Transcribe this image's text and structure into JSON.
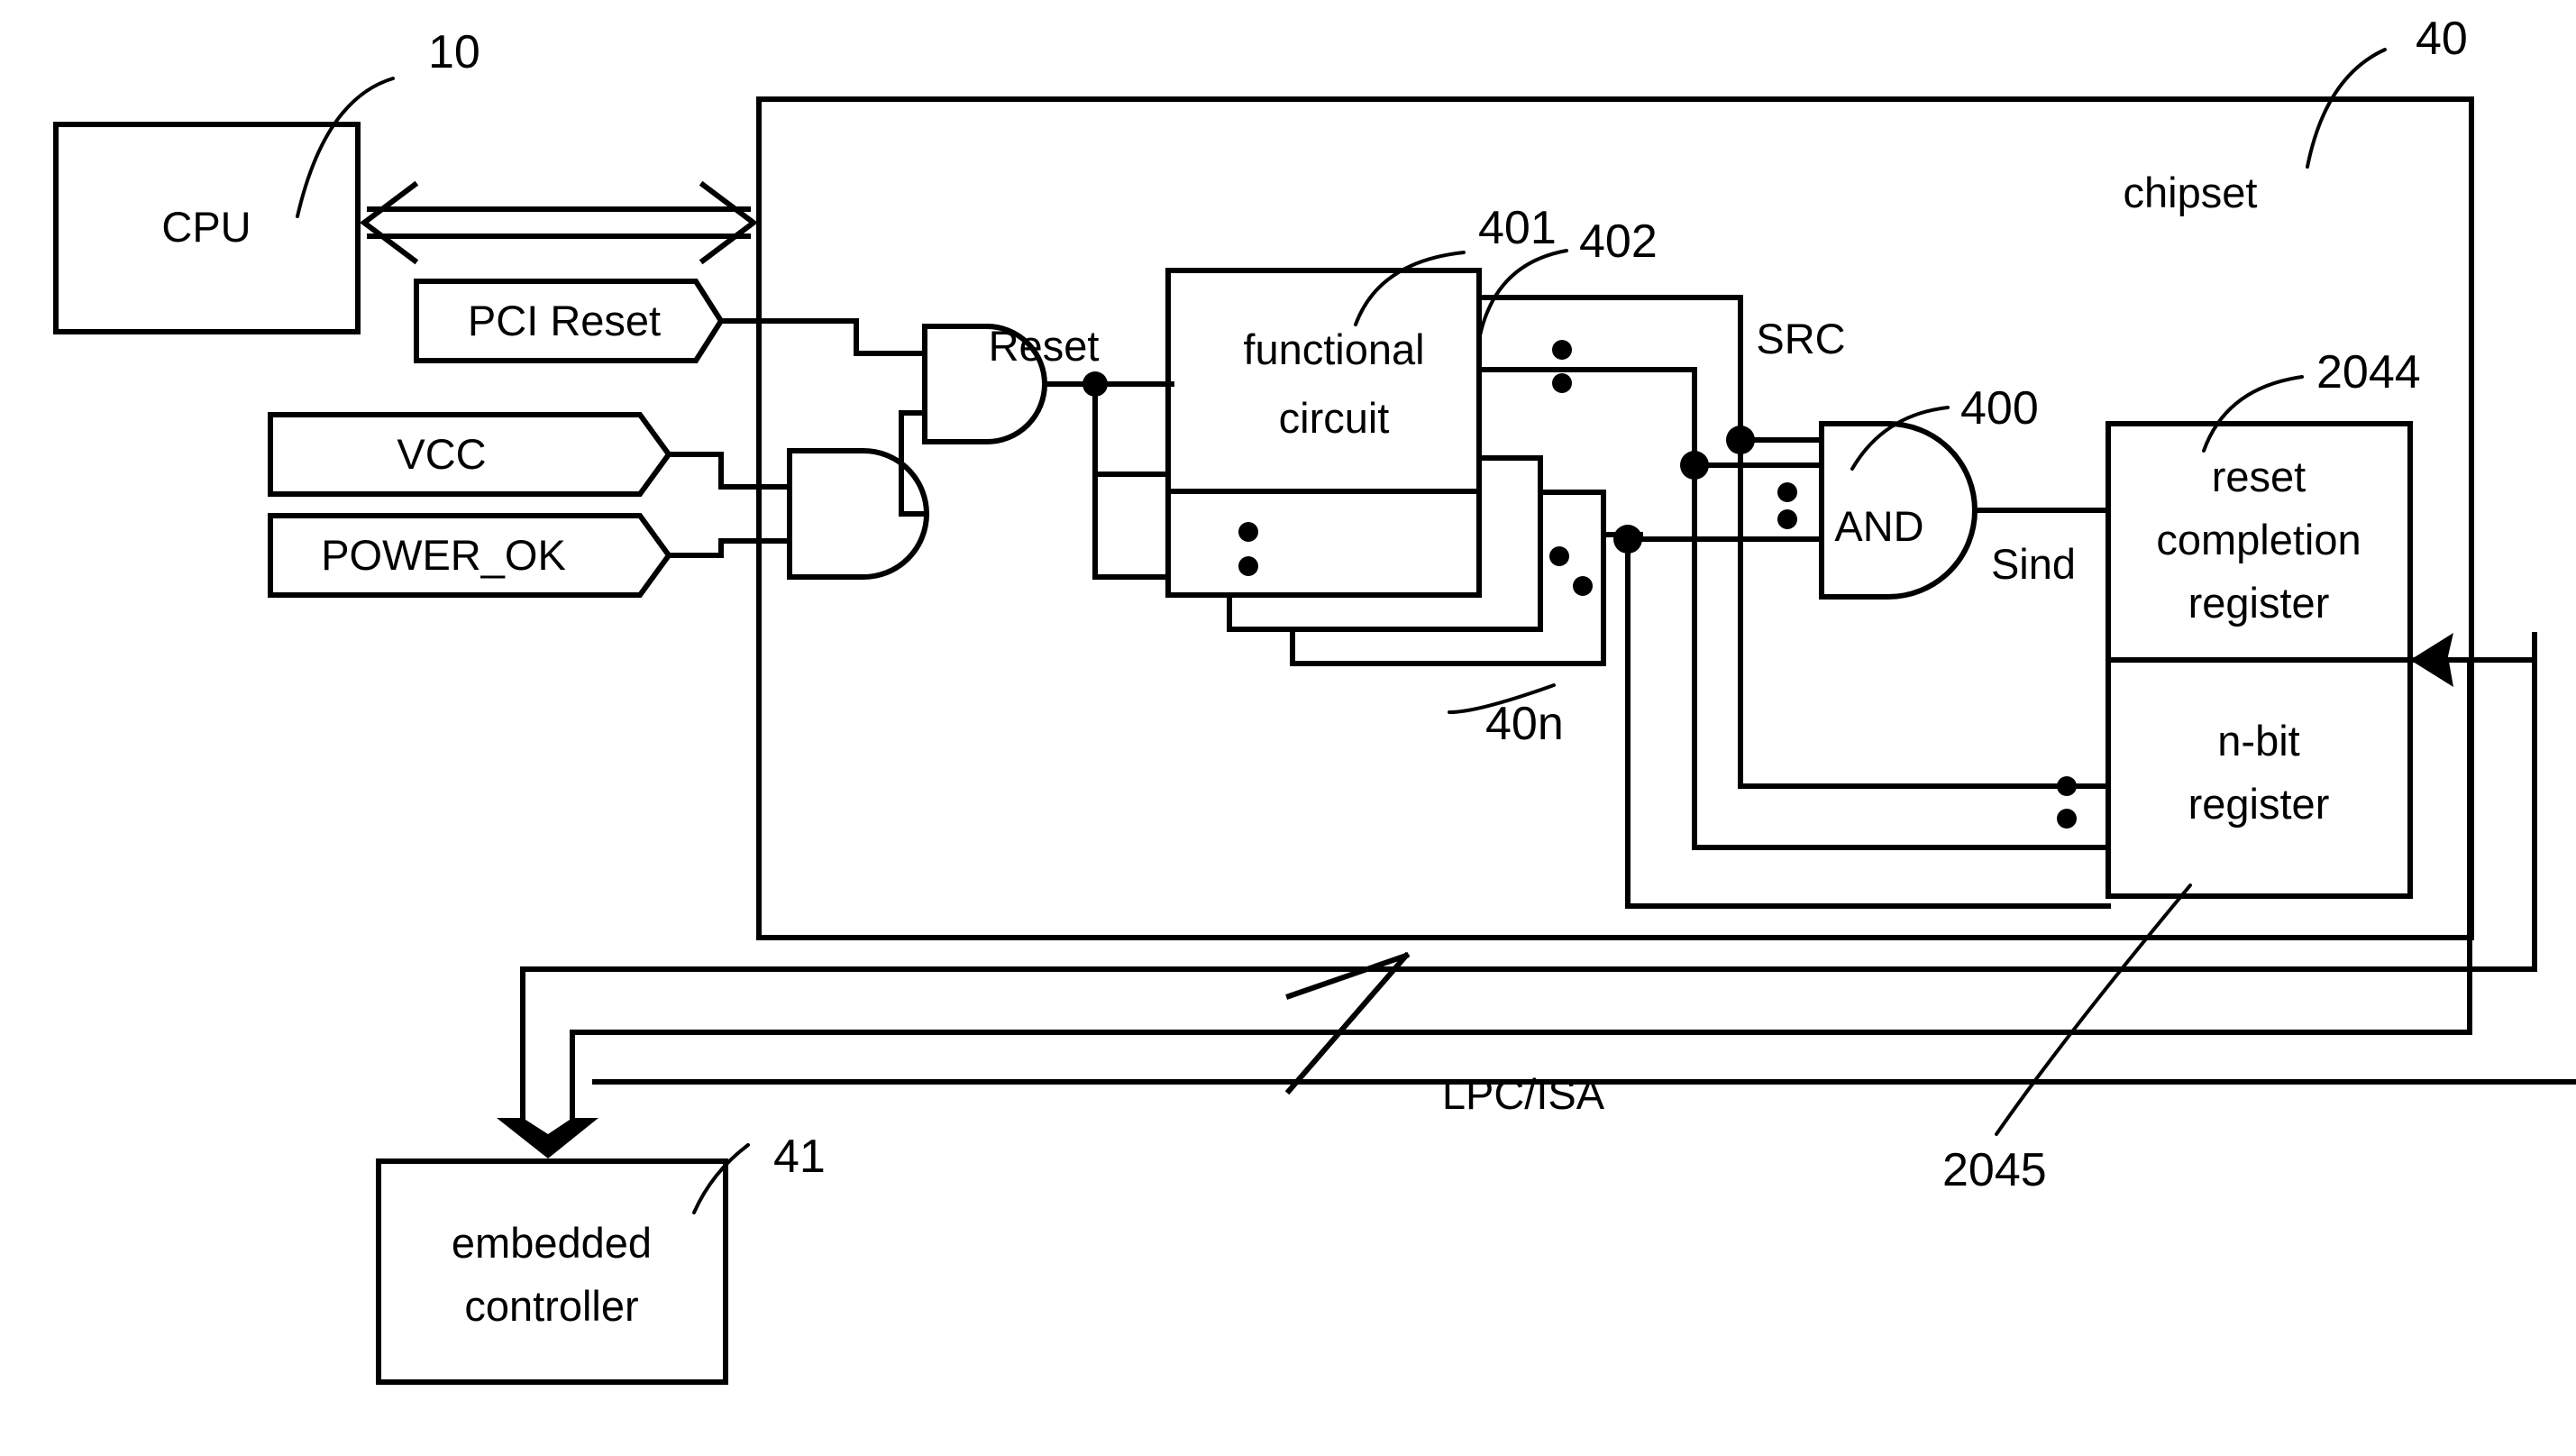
{
  "diagram": {
    "title": "chipset reset completion block diagram",
    "blocks": {
      "cpu": "CPU",
      "chipset": "chipset",
      "functional_circuit_line1": "functional",
      "functional_circuit_line2": "circuit",
      "and_gate": "AND",
      "reset_completion_line1": "reset",
      "reset_completion_line2": "completion",
      "reset_completion_line3": "register",
      "nbit_register_line1": "n-bit",
      "nbit_register_line2": "register",
      "embedded_controller_line1": "embedded",
      "embedded_controller_line2": "controller"
    },
    "signals": {
      "pci_reset": "PCI Reset",
      "vcc": "VCC",
      "power_ok": "POWER_OK",
      "reset": "Reset",
      "src": "SRC",
      "sind": "Sind",
      "bus": "LPC/ISA"
    },
    "refs": {
      "cpu": "10",
      "chipset": "40",
      "functional_circuit": "401",
      "functional_circuit_out": "402",
      "functional_circuit_n": "40n",
      "and_gate": "400",
      "reset_completion_register": "2044",
      "nbit_register": "2045",
      "embedded_controller": "41"
    },
    "colors": {
      "line": "#000000",
      "background": "#ffffff"
    }
  }
}
